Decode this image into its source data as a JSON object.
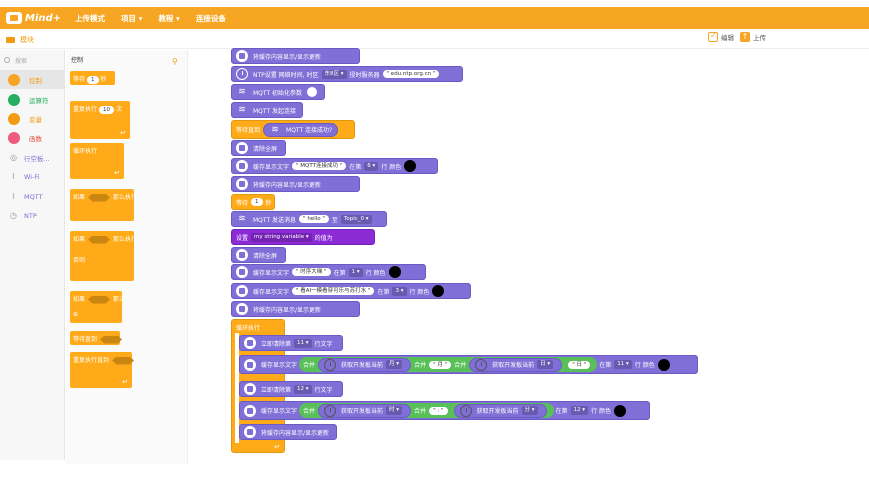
{
  "app": {
    "brand": "Mind+"
  },
  "topbar": {
    "menu": [
      "上传模式",
      "项目 ▾",
      "教程 ▾",
      "连接设备"
    ]
  },
  "tabbar": {
    "blocks_tab": "模块",
    "edit_label": "编辑",
    "upload_label": "上传"
  },
  "sidebar": {
    "search_placeholder": "搜索",
    "categories": [
      {
        "label": "控制",
        "color": "#f6a623"
      },
      {
        "label": "运算符",
        "color": "#27ae60"
      },
      {
        "label": "变量",
        "color": "#f39c12"
      },
      {
        "label": "函数",
        "color": "#ef5b7a"
      },
      {
        "label": "行空板..."
      },
      {
        "label": "Wi-Fi"
      },
      {
        "label": "MQTT"
      },
      {
        "label": "NTP"
      }
    ]
  },
  "flyout": {
    "title": "控制",
    "wait": "等待",
    "wait_num": "1",
    "sec": "秒",
    "repeat": "重复执行",
    "repeat_num": "10",
    "times": "次",
    "forever": "循环执行",
    "if_then": "如果",
    "then_do": "那么执行",
    "else": "否则",
    "if2": "如果",
    "then2": "那么",
    "wait_until": "等待直到",
    "repeat_until": "重复执行直到"
  },
  "workspace": {
    "b1": "将缓存内容显示/显示更新",
    "b2": {
      "t1": "NTP设置 网络时间, 时区",
      "zone": "东8区 ▾",
      "t2": "授时服务器",
      "server": "\" edu.ntp.org.cn \""
    },
    "b3": "MQTT 初始化参数",
    "b4": "MQTT 发起连接",
    "b5": {
      "t1": "等待直到",
      "cond": "MQTT 连接成功?"
    },
    "b6": "清除全屏",
    "b7": {
      "t1": "缓存显示文字",
      "text": "\" MQTT连接成功 \"",
      "t2": "在第",
      "row": "6 ▾",
      "t3": "行 颜色"
    },
    "b8": "将缓存内容显示/显示更新",
    "b9": {
      "t1": "等待",
      "num": "1",
      "t2": "秒"
    },
    "b10": {
      "t1": "MQTT 发送消息",
      "msg": "\" hello \"",
      "t2": "至",
      "topic": "Topic_0 ▾"
    },
    "b11": {
      "t1": "设置",
      "var": "my string variable ▾",
      "t2": "的值为"
    },
    "b12": "清除全屏",
    "b13": {
      "t1": "缓存显示文字",
      "text": "\" 时序大梯 \"",
      "t2": "在第",
      "row": "1 ▾",
      "t3": "行 颜色"
    },
    "b14": {
      "t1": "缓存显示文字",
      "text": "\" 看AI一模看穿可乐与苏打水 \"",
      "t2": "在第",
      "row": "3 ▾",
      "t3": "行 颜色"
    },
    "b15": "将缓存内容显示/显示更新",
    "b16": "循环执行",
    "b17": {
      "t1": "立即清除第",
      "row": "11 ▾",
      "t2": "行文字"
    },
    "b18": {
      "t1": "缓存显示文字",
      "join": "合并",
      "get": "获取开发板当前",
      "month": "月 ▾",
      "join2": "合并",
      "mstr": "\" 月 \"",
      "join3": "合并",
      "get2": "获取开发板当前",
      "day": "日 ▾",
      "dstr": "\" 日 \"",
      "t2": "在第",
      "row": "11 ▾",
      "t3": "行 颜色"
    },
    "b19": {
      "t1": "立即清除第",
      "row": "12 ▾",
      "t2": "行文字"
    },
    "b20": {
      "t1": "缓存显示文字",
      "join": "合并",
      "get": "获取开发板当前",
      "hour": "时 ▾",
      "join2": "合并",
      "sep": "\" : \"",
      "get2": "获取开发板当前",
      "min": "分 ▾",
      "t2": "在第",
      "row": "12 ▾",
      "t3": "行 颜色"
    },
    "b21": "将缓存内容显示/显示更新"
  }
}
